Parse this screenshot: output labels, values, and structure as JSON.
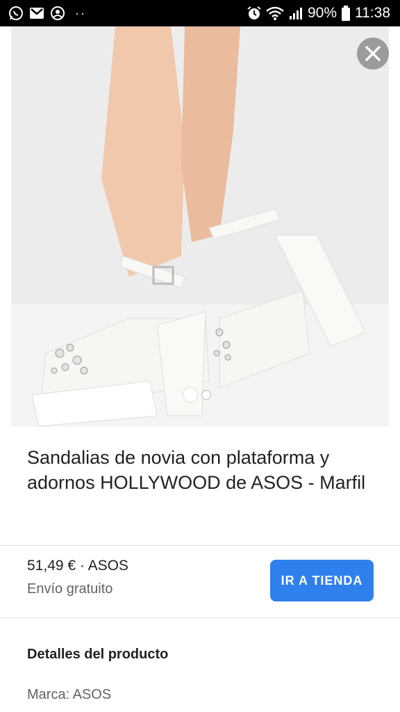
{
  "status_bar": {
    "battery": "90%",
    "time": "11:38"
  },
  "product": {
    "title": "Sandalias de novia con plataforma y adornos HOLLYWOOD de ASOS - Marfil",
    "price_line": "51,49 € · ASOS",
    "shipping": "Envío gratuito",
    "store_button": "IR A TIENDA"
  },
  "details": {
    "heading": "Detalles del producto",
    "brand": "Marca: ASOS"
  },
  "carousel": {
    "count": 2,
    "active_index": 0
  },
  "colors": {
    "accent_button": "#2f80ed",
    "status_bar_bg": "#000000"
  },
  "icons": [
    "whatsapp-icon",
    "gmail-icon",
    "account-icon",
    "alarm-icon",
    "wifi-icon",
    "signal-icon",
    "battery-icon",
    "close-icon"
  ]
}
